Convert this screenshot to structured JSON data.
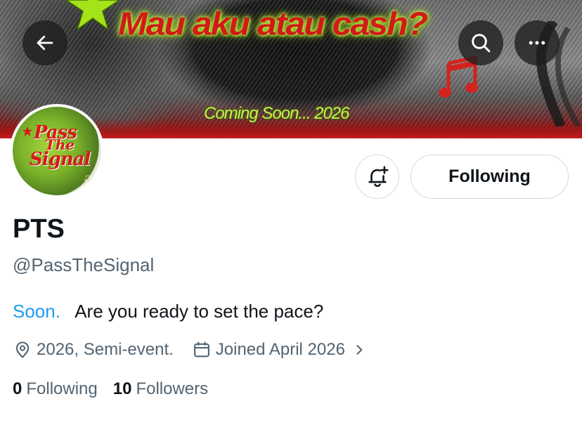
{
  "banner": {
    "title": "Mau aku atau cash?",
    "subtitle": "Coming Soon... 2026"
  },
  "header": {
    "back_icon": "arrow-left-icon",
    "search_icon": "search-icon",
    "more_icon": "more-dots-icon"
  },
  "avatar": {
    "line1": "Pass",
    "line2": "The",
    "line3": "Signal"
  },
  "actions": {
    "notify_icon": "bell-plus-icon",
    "following_label": "Following"
  },
  "profile": {
    "display_name": "PTS",
    "handle": "@PassTheSignal",
    "bio_link": "Soon.",
    "bio_text": "   Are you ready to set the pace?",
    "location": "2026, Semi-event.",
    "joined": "Joined April 2026"
  },
  "stats": {
    "following_count": "0",
    "following_label": "Following",
    "followers_count": "10",
    "followers_label": "Followers"
  },
  "colors": {
    "link": "#1d9bf0",
    "secondary_text": "#536471",
    "primary_text": "#0f1419",
    "border": "#cfd9de"
  }
}
